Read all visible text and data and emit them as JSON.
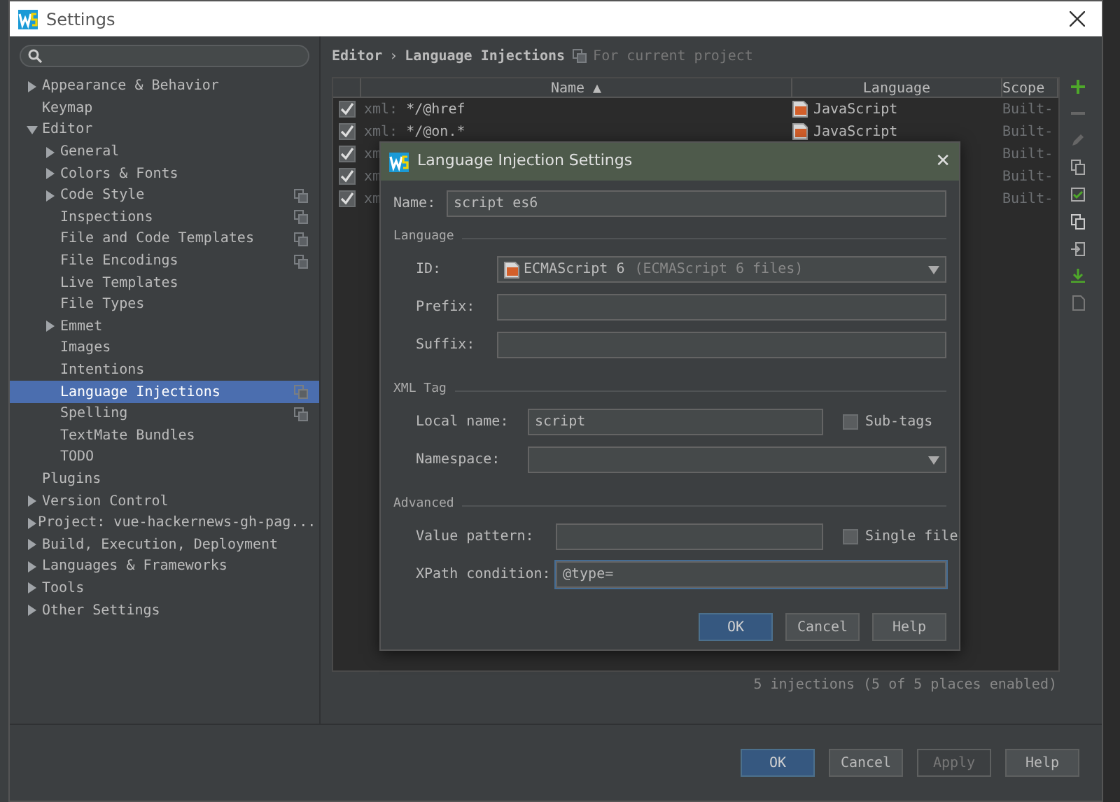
{
  "window": {
    "title": "Settings"
  },
  "sidebar": {
    "items": [
      {
        "label": "Appearance & Behavior",
        "expanded": false,
        "selected": false
      },
      {
        "label": "Keymap",
        "selected": false
      },
      {
        "label": "Editor",
        "expanded": true,
        "selected": false,
        "children": [
          {
            "label": "General",
            "expanded": false,
            "selected": false
          },
          {
            "label": "Colors & Fonts",
            "expanded": false,
            "selected": false
          },
          {
            "label": "Code Style",
            "expanded": false,
            "selected": false,
            "project_level": true
          },
          {
            "label": "Inspections",
            "selected": false,
            "project_level": true
          },
          {
            "label": "File and Code Templates",
            "selected": false,
            "project_level": true
          },
          {
            "label": "File Encodings",
            "selected": false,
            "project_level": true
          },
          {
            "label": "Live Templates",
            "selected": false
          },
          {
            "label": "File Types",
            "selected": false
          },
          {
            "label": "Emmet",
            "expanded": false,
            "selected": false
          },
          {
            "label": "Images",
            "selected": false
          },
          {
            "label": "Intentions",
            "selected": false
          },
          {
            "label": "Language Injections",
            "selected": true,
            "project_level": true
          },
          {
            "label": "Spelling",
            "selected": false,
            "project_level": true
          },
          {
            "label": "TextMate Bundles",
            "selected": false
          },
          {
            "label": "TODO",
            "selected": false
          }
        ]
      },
      {
        "label": "Plugins",
        "selected": false
      },
      {
        "label": "Version Control",
        "expanded": false,
        "selected": false
      },
      {
        "label": "Project: vue-hackernews-gh-pag...",
        "expanded": false,
        "selected": false
      },
      {
        "label": "Build, Execution, Deployment",
        "expanded": false,
        "selected": false
      },
      {
        "label": "Languages & Frameworks",
        "expanded": false,
        "selected": false
      },
      {
        "label": "Tools",
        "expanded": false,
        "selected": false
      },
      {
        "label": "Other Settings",
        "expanded": false,
        "selected": false
      }
    ]
  },
  "breadcrumb": {
    "items": [
      "Editor",
      "Language Injections"
    ],
    "separator": "›",
    "scope_note": "For current project"
  },
  "table": {
    "columns": [
      "Name ▲",
      "Language",
      "Scope"
    ],
    "rows": [
      {
        "checked": true,
        "prefix": "xml:",
        "name": "*/@href",
        "language": "JavaScript",
        "scope": "Built-"
      },
      {
        "checked": true,
        "prefix": "xml:",
        "name": "*/@on.*",
        "language": "JavaScript",
        "scope": "Built-"
      },
      {
        "checked": true,
        "prefix": "xm",
        "scope": "Built-"
      },
      {
        "checked": true,
        "prefix": "xm",
        "scope": "Built-"
      },
      {
        "checked": true,
        "prefix": "xm",
        "scope": "Built-"
      }
    ]
  },
  "status": "5 injections (5 of 5 places enabled)",
  "buttons": [
    {
      "label": "OK",
      "kind": "primary",
      "disabled": false
    },
    {
      "label": "Cancel",
      "kind": "normal",
      "disabled": false
    },
    {
      "label": "Apply",
      "kind": "normal",
      "disabled": true
    },
    {
      "label": "Help",
      "kind": "normal",
      "disabled": false
    }
  ],
  "dialog": {
    "title": "Language Injection Settings",
    "close": "✕",
    "name": {
      "label": "Name:",
      "value": "script es6"
    },
    "sections": [
      {
        "title": "Language",
        "fields": [
          {
            "kind": "dropdown",
            "label": "ID:",
            "value": "ECMAScript 6",
            "hint": "(ECMAScript 6 files)"
          },
          {
            "kind": "text",
            "label": "Prefix:"
          },
          {
            "kind": "text",
            "label": "Suffix:"
          }
        ]
      },
      {
        "title": "XML Tag",
        "fields": [
          {
            "kind": "text_check",
            "label": "Local name:",
            "value": "script",
            "check_label": "Sub-tags",
            "checked": false
          },
          {
            "kind": "dropdown",
            "label": "Namespace:"
          }
        ]
      },
      {
        "title": "Advanced",
        "fields": [
          {
            "kind": "text_check",
            "label": "Value pattern:",
            "check_label": "Single file",
            "checked": false
          },
          {
            "kind": "text",
            "label": "XPath condition:",
            "value": "@type=",
            "focused": true
          }
        ]
      }
    ],
    "buttons": [
      {
        "label": "OK",
        "kind": "primary"
      },
      {
        "label": "Cancel",
        "kind": "normal"
      },
      {
        "label": "Help",
        "kind": "normal"
      }
    ]
  }
}
